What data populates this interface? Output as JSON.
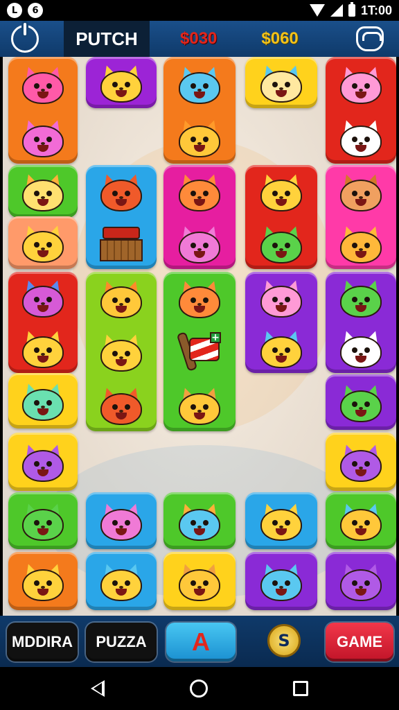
{
  "status_bar": {
    "left_icons": [
      "notification-icon",
      "app-icon"
    ],
    "right_icons": [
      "wifi-icon",
      "signal-icon",
      "battery-icon"
    ],
    "time": "1T:00"
  },
  "header": {
    "left_icon": "power-icon",
    "title": "PUTCH",
    "score_red": "$030",
    "score_gold": "$060",
    "right_icon": "cart-icon"
  },
  "board": {
    "tiles": [
      {
        "color": "#f47a1c",
        "cells": [
          {
            "kind": "cat",
            "head": "#ff5aa8",
            "ear": "#ff5aa8"
          },
          {
            "kind": "cat",
            "head": "#f26bd6",
            "ear": "#f26bd6"
          }
        ]
      },
      {
        "color": "#9c24d6",
        "cells": [
          {
            "kind": "cat",
            "head": "#ffd23c",
            "ear": "#ffd23c"
          }
        ]
      },
      {
        "color": "#f47a1c",
        "cells": [
          {
            "kind": "cat",
            "head": "#5ac8f0",
            "ear": "#5ac8f0"
          },
          {
            "kind": "cat",
            "head": "#ffc83a",
            "ear": "#ff9a2a"
          }
        ]
      },
      {
        "color": "#ffd21c",
        "cells": [
          {
            "kind": "cat",
            "head": "#ffe8a0",
            "ear": "#5ac8f0"
          }
        ]
      },
      {
        "color": "#e2261c",
        "cells": [
          {
            "kind": "cat",
            "head": "#ff9ad6",
            "ear": "#ff9ad6"
          },
          {
            "kind": "cat",
            "head": "#ffffff",
            "ear": "#ffffff"
          }
        ]
      },
      {
        "color": "#4ec82a",
        "cells": [
          {
            "kind": "cat",
            "head": "#ffe070",
            "ear": "#ffb03a"
          }
        ]
      },
      {
        "color": "#ff9a6a",
        "cells": [
          {
            "kind": "cat",
            "head": "#ffd23c",
            "ear": "#ffd23c"
          }
        ]
      },
      {
        "color": "#2aa6e8",
        "cells": [
          {
            "kind": "cat",
            "head": "#f05a2a",
            "ear": "#f05a2a"
          },
          {
            "kind": "barn"
          }
        ]
      },
      {
        "color": "#e61ea0",
        "cells": [
          {
            "kind": "cat",
            "head": "#ff8a3a",
            "ear": "#ff8a3a"
          },
          {
            "kind": "cat",
            "head": "#f07ad6",
            "ear": "#f07ad6"
          }
        ]
      },
      {
        "color": "#e2261c",
        "cells": [
          {
            "kind": "cat",
            "head": "#ffd23c",
            "ear": "#ffd23c"
          },
          {
            "kind": "cat",
            "head": "#5ad24a",
            "ear": "#5ad24a"
          }
        ]
      },
      {
        "color": "#ff3aa8",
        "cells": [
          {
            "kind": "cat",
            "head": "#f0a060",
            "ear": "#d2782a"
          },
          {
            "kind": "cat",
            "head": "#ffb83a",
            "ear": "#ffb83a"
          }
        ]
      },
      {
        "color": "#e2261c",
        "cells": [
          {
            "kind": "cat",
            "head": "#d65ad6",
            "ear": "#5a8af0"
          },
          {
            "kind": "cat",
            "head": "#ffd23c",
            "ear": "#ffd23c"
          }
        ]
      },
      {
        "color": "#8ad21e",
        "cells": [
          {
            "kind": "cat",
            "head": "#ffc83a",
            "ear": "#ff8a2a"
          },
          {
            "kind": "cat",
            "head": "#ffd23c",
            "ear": "#ffd23c"
          },
          {
            "kind": "cat",
            "head": "#f05a2a",
            "ear": "#f05a2a"
          }
        ]
      },
      {
        "color": "#4ec82a",
        "cells": [
          {
            "kind": "cat",
            "head": "#ff8a3a",
            "ear": "#ff8a3a"
          },
          {
            "kind": "flag"
          },
          {
            "kind": "cat",
            "head": "#ffc83a",
            "ear": "#f0a040"
          }
        ]
      },
      {
        "color": "#8a2ad6",
        "cells": [
          {
            "kind": "cat",
            "head": "#ff9ad6",
            "ear": "#ff9ad6"
          },
          {
            "kind": "cat",
            "head": "#ffd23c",
            "ear": "#5ac8f0"
          }
        ]
      },
      {
        "color": "#8a2ad6",
        "cells": [
          {
            "kind": "cat",
            "head": "#5ad24a",
            "ear": "#5ad24a"
          },
          {
            "kind": "cat",
            "head": "#ffffff",
            "ear": "#ffffff"
          }
        ]
      },
      {
        "color": "#ffd21c",
        "cells": [
          {
            "kind": "cat",
            "head": "#6ae0b0",
            "ear": "#6ae0b0"
          }
        ]
      },
      {
        "color": "#8a2ad6",
        "cells": [
          {
            "kind": "cat",
            "head": "#5ad24a",
            "ear": "#5ad24a"
          }
        ]
      },
      {
        "color": "#ffd21c",
        "cells": [
          {
            "kind": "cat",
            "head": "#b05ae6",
            "ear": "#b05ae6"
          }
        ]
      },
      {
        "color": "#ffd21c",
        "cells": [
          {
            "kind": "cat",
            "head": "#b05ae6",
            "ear": "#b05ae6"
          }
        ]
      },
      {
        "color": "#4ec82a",
        "cells": [
          {
            "kind": "cat",
            "head": "#5ad24a",
            "ear": "#5ad24a"
          }
        ]
      },
      {
        "color": "#2aa6e8",
        "cells": [
          {
            "kind": "cat",
            "head": "#f07ad6",
            "ear": "#f07ad6"
          }
        ]
      },
      {
        "color": "#4ec82a",
        "cells": [
          {
            "kind": "cat",
            "head": "#5ac8f0",
            "ear": "#ffb03a"
          }
        ]
      },
      {
        "color": "#2aa6e8",
        "cells": [
          {
            "kind": "cat",
            "head": "#ffd23c",
            "ear": "#ffd23c"
          }
        ]
      },
      {
        "color": "#4ec82a",
        "cells": [
          {
            "kind": "cat",
            "head": "#ffc83a",
            "ear": "#5ac8f0"
          }
        ]
      },
      {
        "color": "#f47a1c",
        "cells": [
          {
            "kind": "cat",
            "head": "#ffd23c",
            "ear": "#ffd23c"
          }
        ]
      },
      {
        "color": "#2aa6e8",
        "cells": [
          {
            "kind": "cat",
            "head": "#ffd23c",
            "ear": "#5ac8f0"
          }
        ]
      },
      {
        "color": "#ffd21c",
        "cells": [
          {
            "kind": "cat",
            "head": "#ffc83a",
            "ear": "#f0a040"
          }
        ]
      },
      {
        "color": "#8a2ad6",
        "cells": [
          {
            "kind": "cat",
            "head": "#5ac8f0",
            "ear": "#5ac8f0"
          }
        ]
      },
      {
        "color": "#8a2ad6",
        "cells": [
          {
            "kind": "cat",
            "head": "#b05ae6",
            "ear": "#b05ae6"
          }
        ]
      }
    ]
  },
  "bottom_bar": {
    "btn1": "MDDIRA",
    "btn2": "PUZZA",
    "btn3": "A",
    "coin": "S",
    "btn5": "GAME"
  },
  "nav_bar": {
    "icons": [
      "back-icon",
      "home-icon",
      "recents-icon"
    ]
  }
}
